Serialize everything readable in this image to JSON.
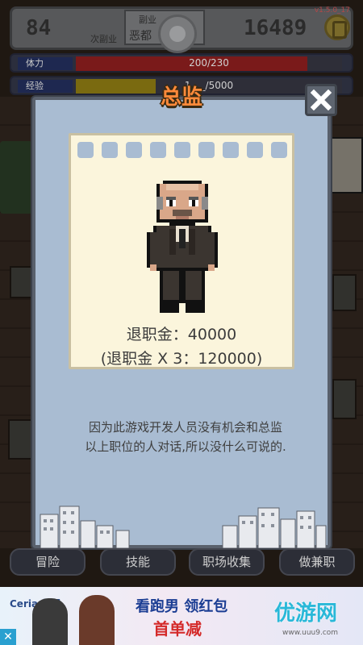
{
  "hud": {
    "level": "84",
    "level_label": "次副业",
    "job_line1": "副业",
    "job_line2": "恶都",
    "money": "16489",
    "version": "v1.5.0_17",
    "stamina_label": "体力",
    "stamina_value": "200/230",
    "stamina_fraction": 0.87,
    "exp_label": "经验",
    "exp_value": "1___/5000",
    "exp_fraction": 0.3
  },
  "modal": {
    "title": "总监",
    "severance": "退职金：40000",
    "severance_triple": "(退职金 X 3：120000)",
    "description_line1": "因为此游戏开发人员没有机会和总监",
    "description_line2": "以上职位的人对话,所以没什么可说的."
  },
  "tabs": [
    {
      "label": "冒险"
    },
    {
      "label": "技能"
    },
    {
      "label": "职场收集"
    },
    {
      "label": "做兼职"
    }
  ],
  "ad": {
    "brand": "Ceria 佛罗",
    "slogan1": "看跑男 领红包",
    "slogan2": "首单减",
    "logo": "优游网",
    "url": "www.uuu9.com",
    "close": "✕"
  },
  "colors": {
    "title_orange": "#ff8a3a",
    "modal_bg": "#a9bcd2",
    "card_bg": "#fbf5dc",
    "stamina_red": "#7a1a1a",
    "exp_yellow": "#7a6a10"
  }
}
